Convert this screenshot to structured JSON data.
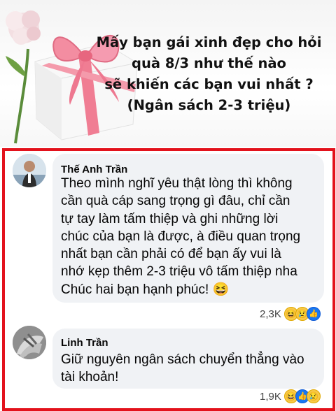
{
  "banner": {
    "headline_lines": [
      "Mấy bạn gái xinh đẹp cho hỏi",
      "quà 8/3 như thế nào",
      "sẽ khiến các bạn vui nhất ?",
      "(Ngân sách 2-3 triệu)"
    ]
  },
  "comments": [
    {
      "author": "Thế Anh Trần",
      "lines": [
        "Theo mình nghĩ yêu thật lòng thì không",
        "cần quà cáp sang trọng gì đâu, chỉ cần",
        "tự tay làm tấm thiệp và ghi những lời",
        "chúc của bạn là được, à điều quan trọng",
        "nhất bạn cần phải có để bạn ấy vui là",
        "nhớ kẹp thêm 2-3 triệu vô tấm thiệp nha",
        "Chúc hai bạn hạnh phúc! 😆"
      ],
      "reaction_count": "2,3K",
      "reactions": [
        "haha-icon",
        "sad-icon",
        "like-icon"
      ]
    },
    {
      "author": "Linh Trần",
      "lines": [
        "Giữ nguyên ngân sách chuyển thẳng vào",
        "tài khoản!"
      ],
      "reaction_count": "1,9K",
      "reactions": [
        "haha-icon",
        "like-icon",
        "sad-icon"
      ]
    }
  ],
  "colors": {
    "frame_border": "#e3121c",
    "bubble_bg": "#f0f2f5",
    "like_blue": "#1877f2"
  }
}
